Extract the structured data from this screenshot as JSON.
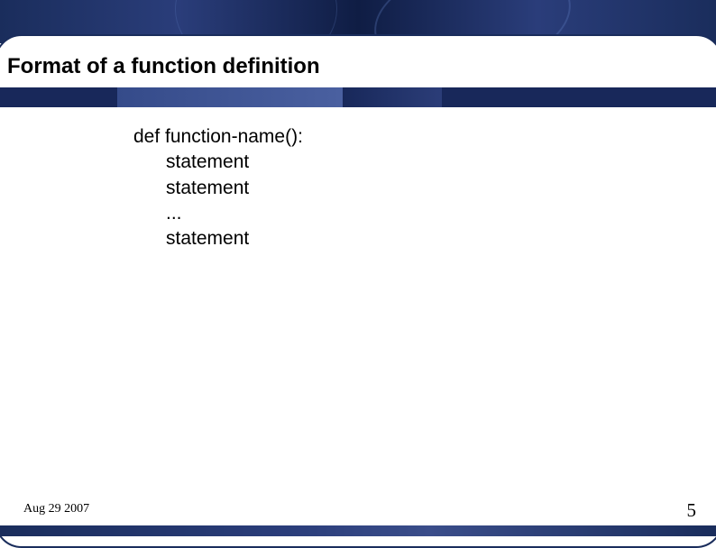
{
  "slide": {
    "title": "Format of a function definition",
    "body": {
      "line1": "def function-name():",
      "line2": "statement",
      "line3": "statement",
      "line4": "...",
      "line5": "statement"
    }
  },
  "footer": {
    "date": "Aug 29 2007",
    "page": "5"
  }
}
